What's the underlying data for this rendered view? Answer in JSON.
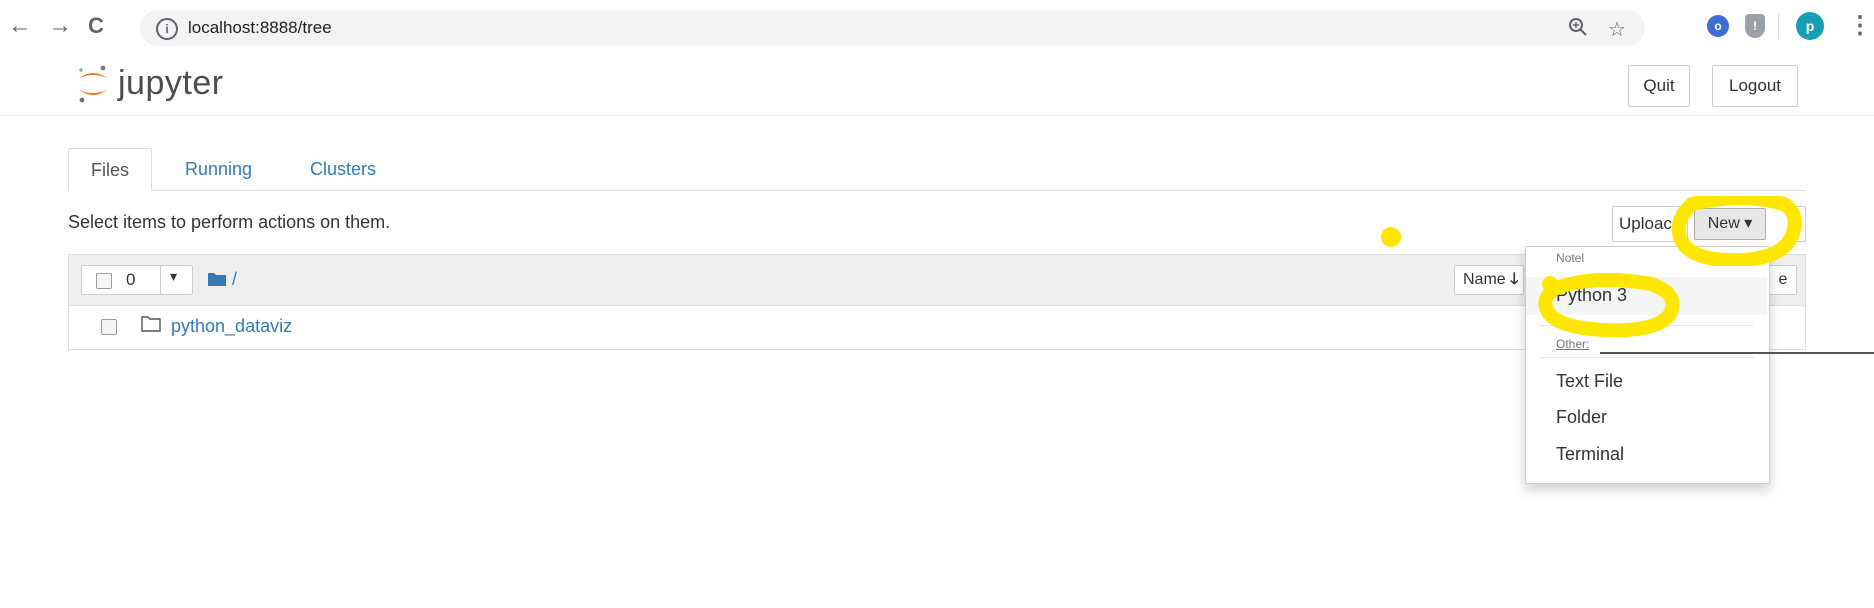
{
  "browser": {
    "url": "localhost:8888/tree",
    "profile_initial": "p"
  },
  "header": {
    "logo_text": "jupyter",
    "quit_label": "Quit",
    "logout_label": "Logout"
  },
  "tabs": [
    {
      "label": "Files",
      "active": true
    },
    {
      "label": "Running",
      "active": false
    },
    {
      "label": "Clusters",
      "active": false
    }
  ],
  "toolbar": {
    "help_text": "Select items to perform actions on them.",
    "upload_label": "Uploac",
    "new_label": "New ▾"
  },
  "list": {
    "selected_count": "0",
    "breadcrumb": "/",
    "sort_label": "Name",
    "sort_arrow": "🡓",
    "rows": [
      {
        "name": "python_dataviz",
        "type": "folder"
      }
    ]
  },
  "new_menu": {
    "notebook_header": "Notel",
    "python_label": "Python 3",
    "other_header": "Other:",
    "items": [
      "Text File",
      "Folder",
      "Terminal"
    ]
  },
  "colors": {
    "link": "#337ab7",
    "annotation": "#ffe600",
    "logo_orange": "#f37726"
  }
}
